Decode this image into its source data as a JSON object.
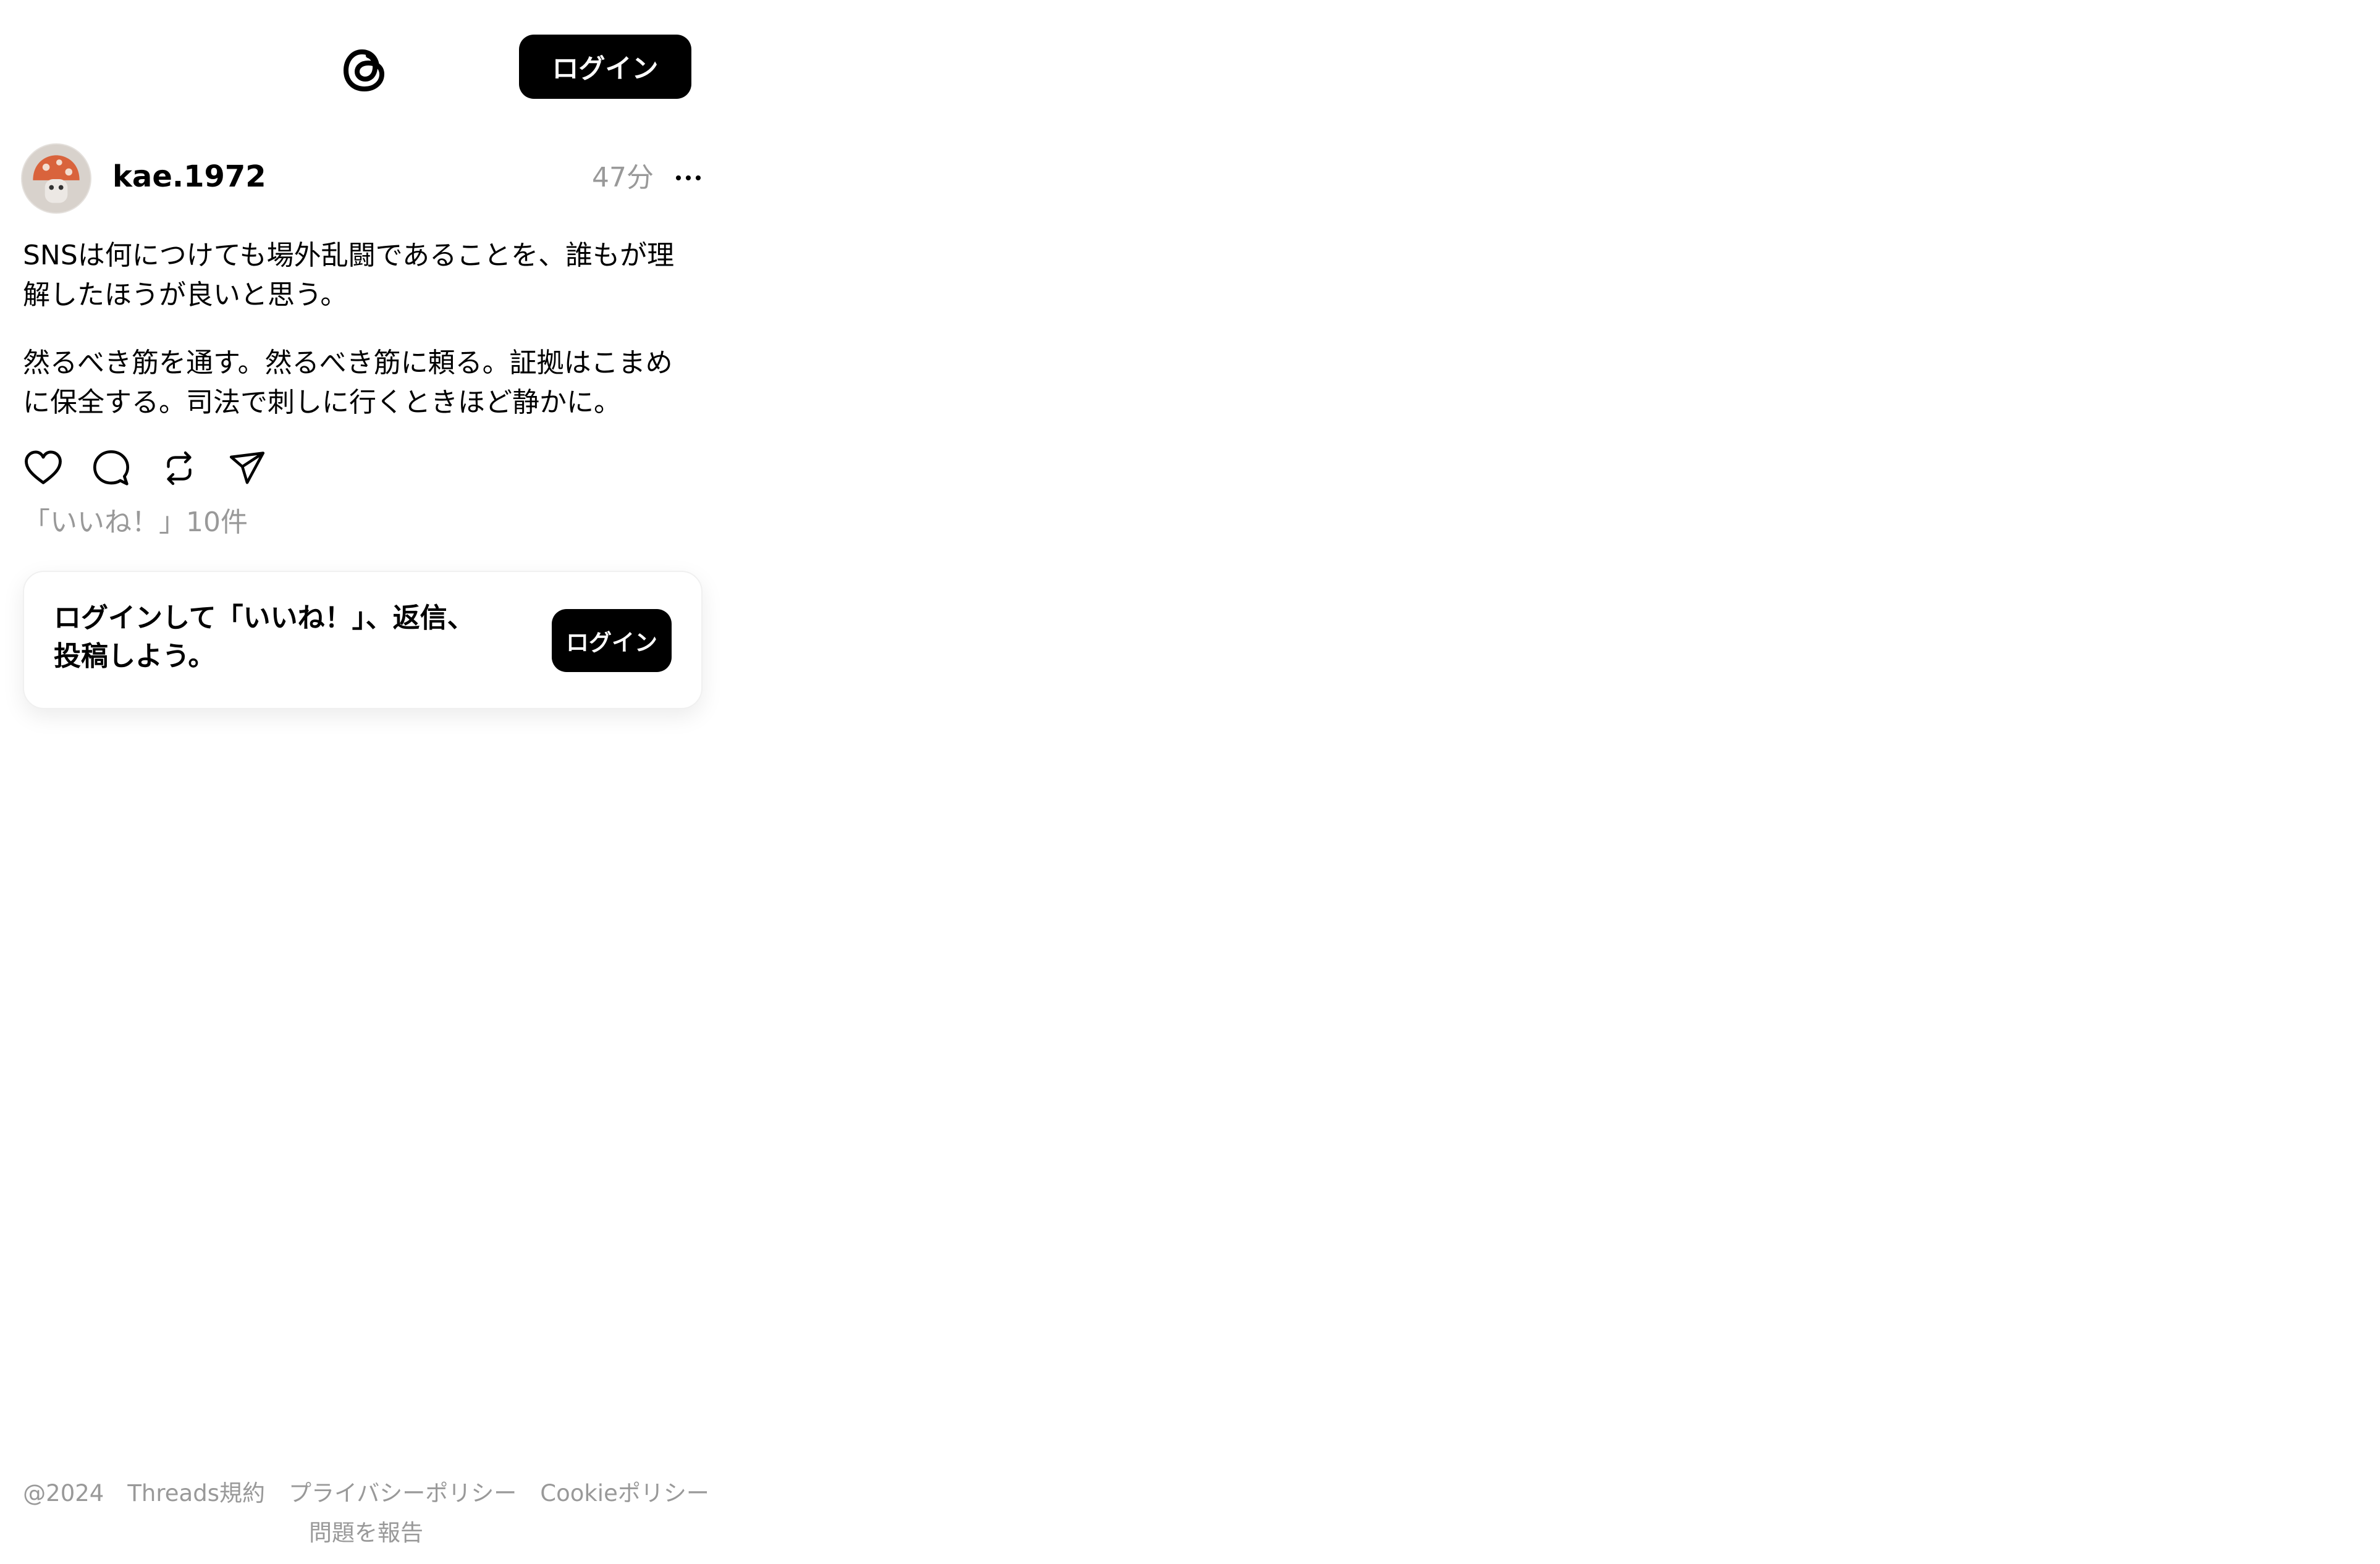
{
  "header": {
    "logo_icon": "threads-logo-icon",
    "login_label": "ログイン"
  },
  "post": {
    "username": "kae.1972",
    "time": "47分",
    "more_icon": "more-horizontal-icon",
    "paragraphs": [
      "SNSは何につけても場外乱闘であることを、誰もが理\n解したほうが良いと思う。",
      "然るべき筋を通す。然るべき筋に頼る。証拠はこまめ\nに保全する。司法で刺しに行くときほど静かに。"
    ],
    "actions": {
      "like_icon": "heart-icon",
      "reply_icon": "comment-icon",
      "repost_icon": "repost-icon",
      "share_icon": "send-icon"
    },
    "likes_text": "「いいね！」10件"
  },
  "login_prompt": {
    "text": "ログインして「いいね！」、返信、\n投稿しよう。",
    "button_label": "ログイン"
  },
  "footer": {
    "copyright": "@2024",
    "terms": "Threads規約",
    "privacy": "プライバシーポリシー",
    "cookie": "Cookieポリシー",
    "report": "問題を報告"
  },
  "colors": {
    "primary": "#000000",
    "muted": "#999999",
    "background": "#ffffff"
  }
}
